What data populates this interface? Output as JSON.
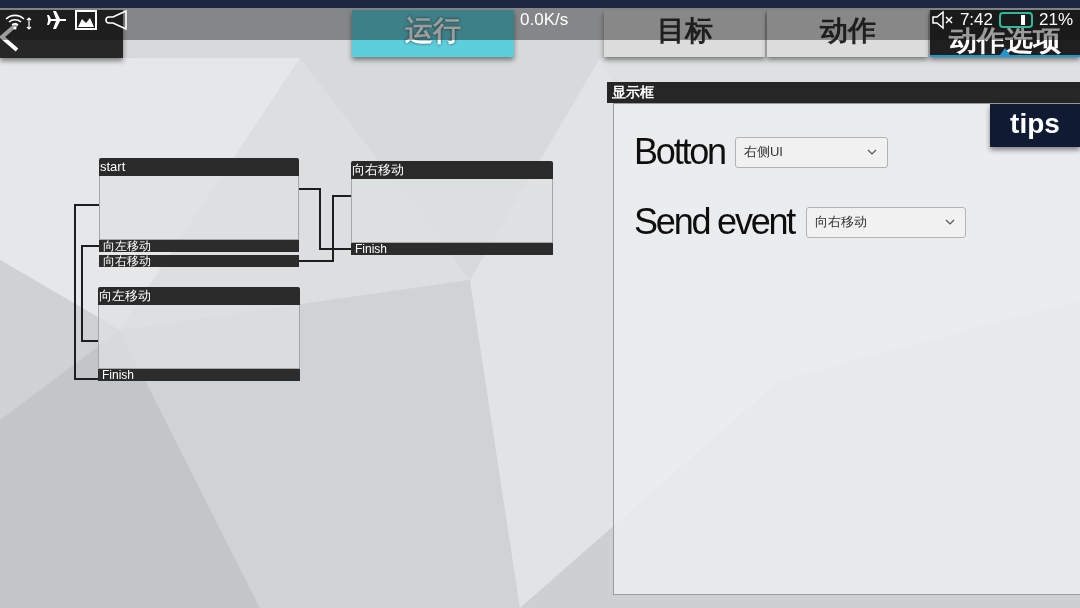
{
  "status_bar": {
    "network_speed": "0.0K/s",
    "time": "7:42",
    "battery": "21%"
  },
  "toolbar": {
    "run_button": {
      "label": "运行"
    },
    "tabs": [
      {
        "label": "目标",
        "selected": false
      },
      {
        "label": "动作",
        "selected": false
      },
      {
        "label": "动作选项",
        "selected": true
      }
    ]
  },
  "graph": {
    "nodes": [
      {
        "title": "start",
        "outputs": [
          "向左移动",
          "向右移动"
        ]
      },
      {
        "title": "向左移动",
        "outputs": [
          "Finish"
        ]
      },
      {
        "title": "向右移动",
        "outputs": [
          "Finish"
        ]
      }
    ]
  },
  "panel": {
    "title": "显示框",
    "tips": "tips",
    "fields": [
      {
        "label": "Botton",
        "value": "右侧UI"
      },
      {
        "label": "Send event",
        "value": "向右移动"
      }
    ]
  }
}
